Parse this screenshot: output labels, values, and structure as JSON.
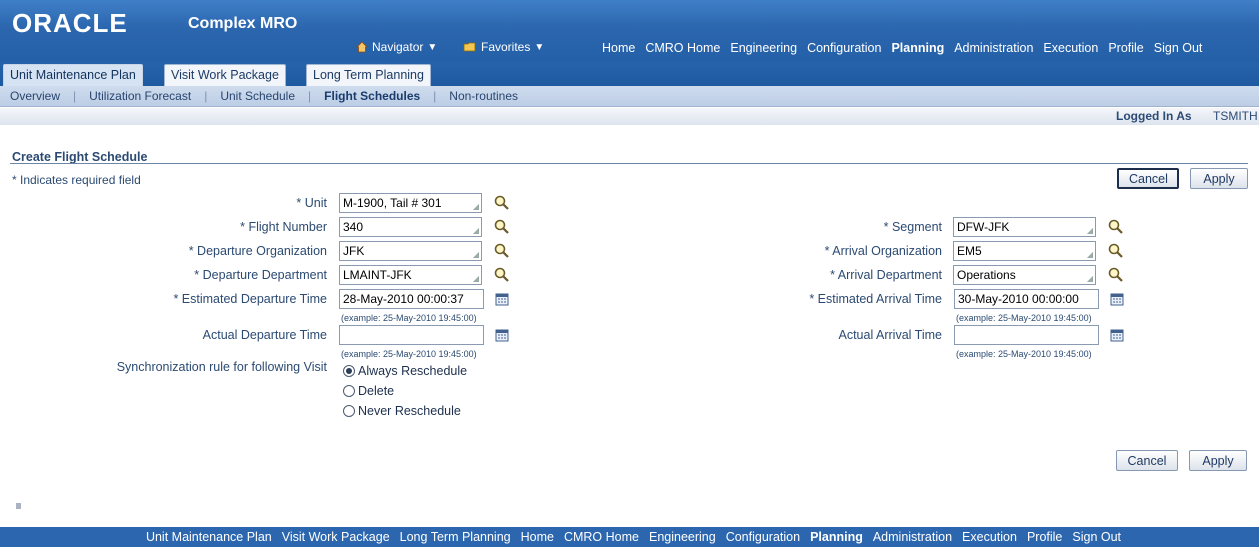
{
  "header": {
    "logo": "ORACLE",
    "app_title": "Complex MRO",
    "navigator": "Navigator",
    "favorites": "Favorites",
    "global_nav": [
      "Home",
      "CMRO Home",
      "Engineering",
      "Configuration",
      "Planning",
      "Administration",
      "Execution",
      "Profile",
      "Sign Out"
    ],
    "active_global": "Planning"
  },
  "tabs": [
    "Unit Maintenance Plan",
    "Visit Work Package",
    "Long Term Planning"
  ],
  "subtabs": [
    "Overview",
    "Utilization Forecast",
    "Unit Schedule",
    "Flight Schedules",
    "Non-routines"
  ],
  "logged_in": {
    "label": "Logged In As",
    "user": "TSMITH"
  },
  "page": {
    "title": "Create Flight Schedule",
    "required_note": "* Indicates required field",
    "cancel": "Cancel",
    "apply": "Apply"
  },
  "form": {
    "unit_label": "* Unit",
    "unit_value": "M-1900, Tail # 301",
    "flight_number_label": "* Flight Number",
    "flight_number_value": "340",
    "dep_org_label": "* Departure Organization",
    "dep_org_value": "JFK",
    "dep_dept_label": "* Departure Department",
    "dep_dept_value": "LMAINT-JFK",
    "est_dep_label": "* Estimated Departure Time",
    "est_dep_value": "28-May-2010 00:00:37",
    "act_dep_label": "Actual Departure Time",
    "act_dep_value": "",
    "segment_label": "* Segment",
    "segment_value": "DFW-JFK",
    "arr_org_label": "* Arrival Organization",
    "arr_org_value": "EM5",
    "arr_dept_label": "* Arrival Department",
    "arr_dept_value": "Operations",
    "est_arr_label": "* Estimated Arrival Time",
    "est_arr_value": "30-May-2010 00:00:00",
    "act_arr_label": "Actual Arrival Time",
    "act_arr_value": "",
    "date_hint": "(example: 25-May-2010 19:45:00)",
    "sync_label": "Synchronization rule for following Visit",
    "sync_options": [
      "Always Reschedule",
      "Delete",
      "Never Reschedule"
    ],
    "sync_selected": "Always Reschedule"
  },
  "footer": {
    "links": [
      "Unit Maintenance Plan",
      "Visit Work Package",
      "Long Term Planning",
      "Home",
      "CMRO Home",
      "Engineering",
      "Configuration",
      "Planning",
      "Administration",
      "Execution",
      "Profile",
      "Sign Out"
    ],
    "active": "Planning"
  }
}
